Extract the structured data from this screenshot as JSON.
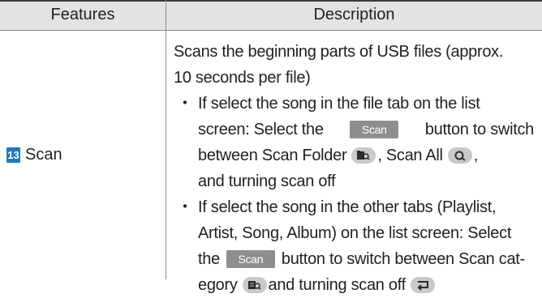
{
  "header": {
    "features": "Features",
    "description": "Description"
  },
  "row": {
    "badge": "13",
    "feature": "Scan",
    "lines": [
      "Scans the beginning parts of USB files (approx.",
      "10 seconds per file)"
    ],
    "bullet1": {
      "l1": "If select the song in the file tab on the list",
      "l2a": "screen: Select the",
      "l2b": "button to switch",
      "l3a": "between Scan Folder",
      "l3b": ", Scan All",
      "l3c": ",",
      "l4": "and turning scan off"
    },
    "bullet2": {
      "l1": "If select the song in the other tabs (Playlist,",
      "l2": "Artist, Song, Album) on the list screen: Select",
      "l3a": "the",
      "l3b": "button to switch between Scan cat-",
      "l4a": "egory",
      "l4b": "and turning scan off"
    },
    "scan_button": "Scan",
    "bullet_char": "・"
  },
  "icons": [
    "scan-folder-icon",
    "scan-all-icon",
    "scan-category-icon",
    "scan-off-icon"
  ]
}
